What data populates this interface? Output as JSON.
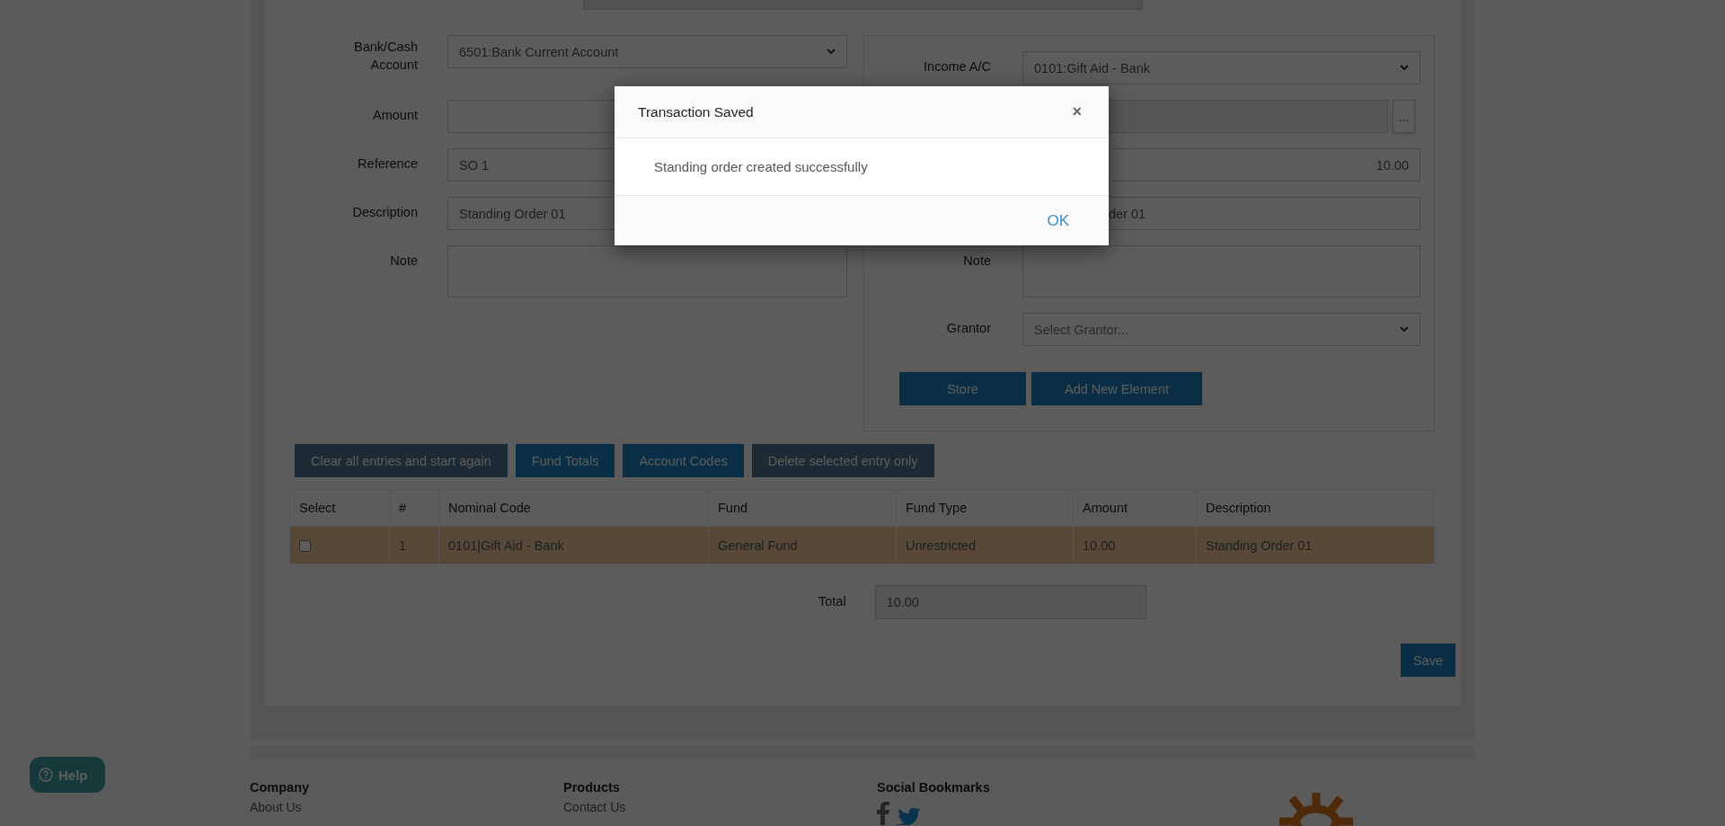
{
  "left_form": {
    "fields": [
      {
        "label": "Bank/Cash Account",
        "kind": "select",
        "value": "6501:Bank Current Account"
      },
      {
        "label": "Amount",
        "kind": "text"
      },
      {
        "label": "Reference",
        "kind": "text",
        "value": "SO 1"
      },
      {
        "label": "Description",
        "kind": "text",
        "value": "Standing Order 01"
      },
      {
        "label": "Note",
        "kind": "textarea"
      }
    ]
  },
  "right_form": {
    "fields": [
      {
        "label": "Income A/C",
        "kind": "select",
        "value": "0101:Gift Aid - Bank"
      },
      {
        "kind": "lookup",
        "button": "..."
      },
      {
        "kind": "number",
        "value": "10.00"
      },
      {
        "kind": "text",
        "value": "der 01"
      },
      {
        "label": "Note",
        "kind": "textarea"
      },
      {
        "label": "Grantor",
        "kind": "select",
        "placeholder": "Select Grantor..."
      }
    ],
    "buttons": [
      "Store",
      "Add New Element"
    ]
  },
  "actions": [
    {
      "label": "Clear all entries and start again",
      "disabled": true
    },
    {
      "label": "Fund Totals",
      "disabled": false
    },
    {
      "label": "Account Codes",
      "disabled": false
    },
    {
      "label": "Delete selected entry only",
      "disabled": true
    }
  ],
  "table": {
    "columns": [
      "Select",
      "#",
      "Nominal Code",
      "Fund",
      "Fund Type",
      "Amount",
      "Description"
    ],
    "rows": [
      {
        "checked": false,
        "highlighted": true,
        "cells": [
          "",
          "1",
          "0101|Gift Aid - Bank",
          "General Fund",
          "Unrestricted",
          "10.00",
          "Standing Order 01"
        ]
      }
    ]
  },
  "total": {
    "label": "Total",
    "value": "10.00"
  },
  "save": "Save",
  "modal": {
    "title": "Transaction Saved",
    "close": "×",
    "message": "Standing order created successfully",
    "ok": "OK"
  },
  "help": "Help",
  "footer": {
    "columns": [
      {
        "kind": "links",
        "heading": "Company",
        "links": [
          "About Us"
        ]
      },
      {
        "kind": "links",
        "heading": "Products",
        "links": [
          "Contact Us"
        ]
      },
      {
        "kind": "social",
        "heading": "Social Bookmarks"
      }
    ]
  }
}
